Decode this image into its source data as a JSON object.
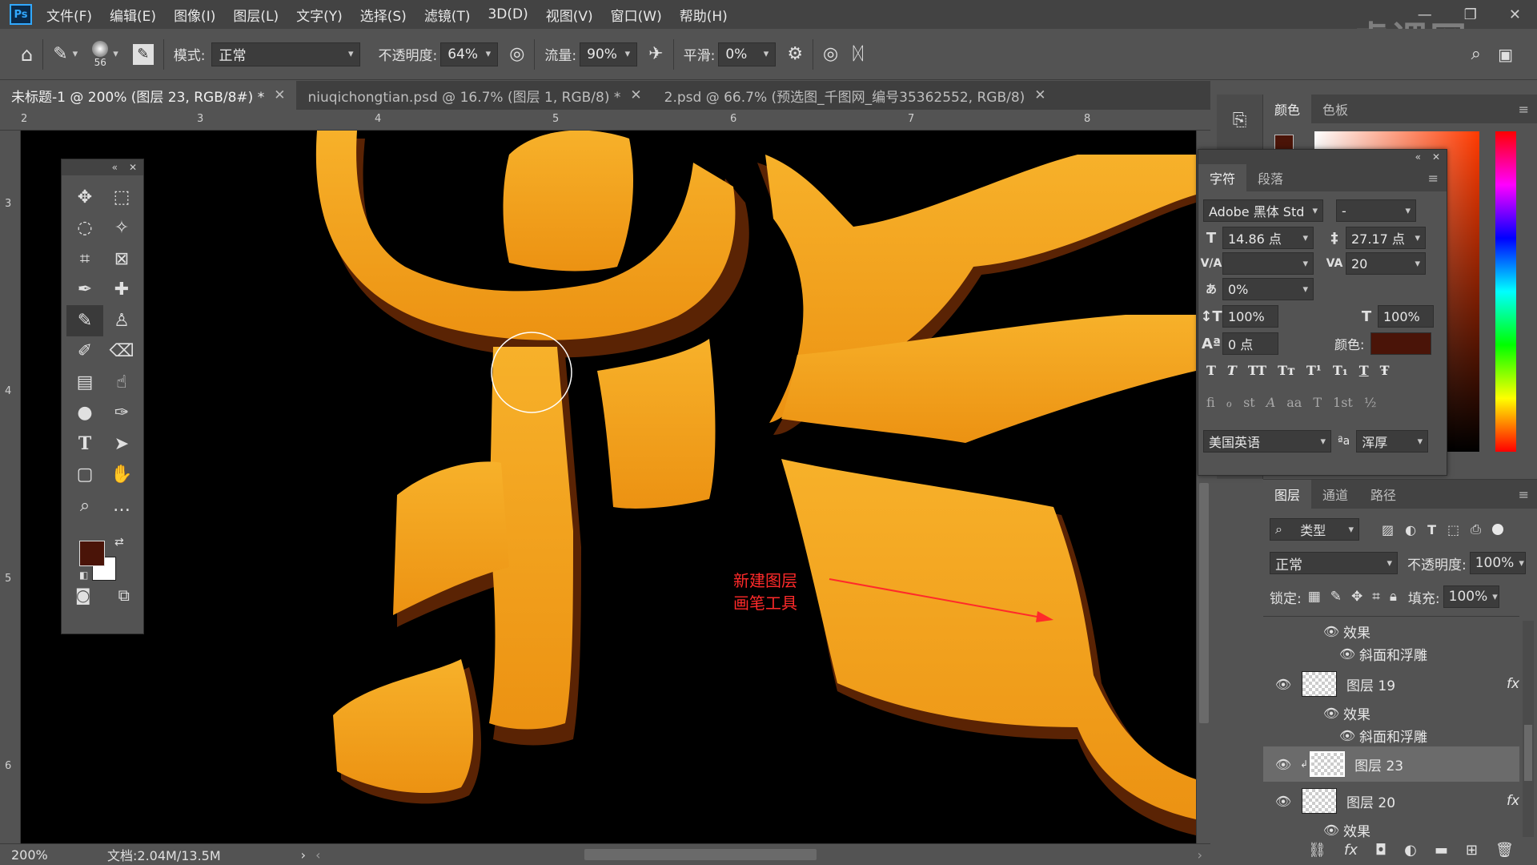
{
  "app": {
    "logo": "Ps"
  },
  "menu": [
    "文件(F)",
    "编辑(E)",
    "图像(I)",
    "图层(L)",
    "文字(Y)",
    "选择(S)",
    "滤镜(T)",
    "3D(D)",
    "视图(V)",
    "窗口(W)",
    "帮助(H)"
  ],
  "watermark": "虎课网",
  "options": {
    "brush_size": "56",
    "mode_label": "模式:",
    "mode_value": "正常",
    "opacity_label": "不透明度:",
    "opacity_value": "64%",
    "flow_label": "流量:",
    "flow_value": "90%",
    "smooth_label": "平滑:",
    "smooth_value": "0%"
  },
  "doc_tabs": [
    {
      "label": "未标题-1 @ 200% (图层 23, RGB/8#) *",
      "active": true
    },
    {
      "label": "niuqichongtian.psd @ 16.7% (图层 1, RGB/8) *",
      "active": false
    },
    {
      "label": "2.psd @ 66.7% (预选图_千图网_编号35362552, RGB/8)",
      "active": false
    }
  ],
  "ruler_h": [
    "2",
    "3",
    "4",
    "5",
    "6",
    "7",
    "8"
  ],
  "ruler_v": [
    "3",
    "4",
    "5",
    "6"
  ],
  "status": {
    "zoom": "200%",
    "doc": "文档:2.04M/13.5M"
  },
  "colors": {
    "foreground": "#4a1408",
    "background": "#ffffff",
    "text_color": "#4a1408",
    "glyph_orange": "#f2a019",
    "glyph_dark": "#6b2a04",
    "annotation": "#ff2a2a"
  },
  "color_panel": {
    "tabs": [
      "颜色",
      "色板"
    ]
  },
  "char_panel": {
    "tabs": [
      "字符",
      "段落"
    ],
    "font_family": "Adobe 黑体 Std",
    "font_style": "-",
    "font_size": "14.86 点",
    "leading": "27.17 点",
    "kerning": "",
    "tracking": "20",
    "tsume": "0%",
    "vscale": "100%",
    "hscale": "100%",
    "baseline": "0 点",
    "color_label": "颜色:",
    "style_buttons": [
      "T",
      "T",
      "TT",
      "Tт",
      "T¹",
      "T₁",
      "T",
      "Ŧ"
    ],
    "opentype_buttons": [
      "fi",
      "ℴ",
      "st",
      "A",
      "aa",
      "T",
      "1st",
      "½"
    ],
    "language": "美国英语",
    "aa_icon": "ªa",
    "antialias": "浑厚"
  },
  "layers_panel": {
    "tabs": [
      "图层",
      "通道",
      "路径"
    ],
    "filter_label": "类型",
    "blend_mode": "正常",
    "opacity_label": "不透明度:",
    "opacity_value": "100%",
    "lock_label": "锁定:",
    "fill_label": "填充:",
    "fill_value": "100%",
    "rows": [
      {
        "kind": "effects",
        "label": "效果"
      },
      {
        "kind": "effect",
        "label": "斜面和浮雕"
      },
      {
        "kind": "layer",
        "label": "图层 19",
        "fx": "fx"
      },
      {
        "kind": "effects",
        "label": "效果"
      },
      {
        "kind": "effect",
        "label": "斜面和浮雕"
      },
      {
        "kind": "layer",
        "label": "图层 23",
        "selected": true
      },
      {
        "kind": "layer",
        "label": "图层 20",
        "fx": "fx"
      },
      {
        "kind": "effects",
        "label": "效果"
      }
    ]
  },
  "annotation": {
    "line1": "新建图层",
    "line2": "画笔工具"
  }
}
